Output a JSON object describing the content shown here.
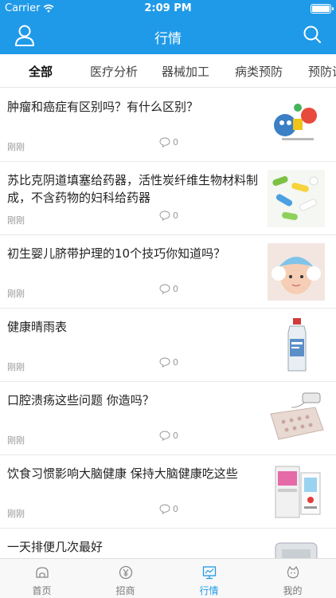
{
  "status_bar": {
    "carrier": "Carrier",
    "time": "2:09 PM"
  },
  "nav": {
    "title": "行情",
    "user_icon": "user-icon",
    "search_icon": "search-icon"
  },
  "tabs": [
    {
      "label": "全部",
      "active": true
    },
    {
      "label": "医疗分析",
      "active": false
    },
    {
      "label": "器械加工",
      "active": false
    },
    {
      "label": "病类预防",
      "active": false
    },
    {
      "label": "预防试",
      "active": false
    }
  ],
  "articles": [
    {
      "title": "肿瘤和癌症有区别吗？有什么区别？",
      "time": "刚刚",
      "comments": "0",
      "thumb": "cartoon-illustration"
    },
    {
      "title": "苏比克阴道填塞给药器，活性炭纤维生物材料制成，不含药物的妇科给药器",
      "time": "刚刚",
      "comments": "0",
      "thumb": "pills-photo"
    },
    {
      "title": "初生婴儿脐带护理的10个技巧你知道吗？",
      "time": "刚刚",
      "comments": "0",
      "thumb": "baby-photo"
    },
    {
      "title": "健康晴雨表",
      "time": "刚刚",
      "comments": "0",
      "thumb": "bottle-photo"
    },
    {
      "title": "口腔溃疡这些问题 你造吗？",
      "time": "刚刚",
      "comments": "0",
      "thumb": "air-mattress-photo"
    },
    {
      "title": "饮食习惯影响大脑健康 保持大脑健康吃这些",
      "time": "刚刚",
      "comments": "0",
      "thumb": "device-photo"
    },
    {
      "title": "一天排便几次最好",
      "time": "",
      "comments": "",
      "thumb": "scale-photo"
    }
  ],
  "tabbar": [
    {
      "label": "首页",
      "icon": "home-icon",
      "active": false
    },
    {
      "label": "招商",
      "icon": "money-icon",
      "active": false
    },
    {
      "label": "行情",
      "icon": "market-icon",
      "active": true
    },
    {
      "label": "我的",
      "icon": "profile-icon",
      "active": false
    }
  ],
  "colors": {
    "header": "#1f9ae8",
    "active_tab": "#1f9ae8"
  }
}
